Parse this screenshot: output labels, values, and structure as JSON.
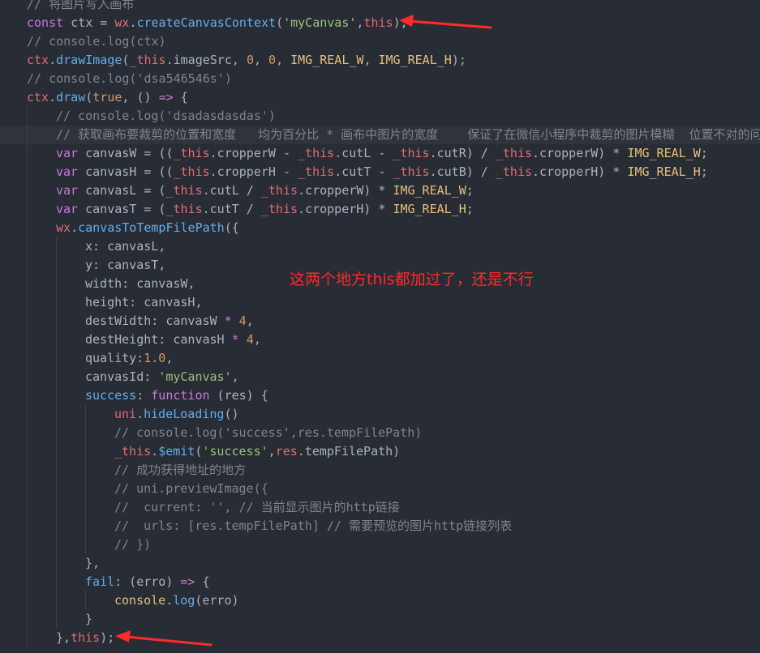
{
  "colors": {
    "background": "#282c34",
    "text": "#abb2bf",
    "keyword": "#c678dd",
    "function": "#61afef",
    "object": "#e06c75",
    "string": "#98c379",
    "number": "#d19a66",
    "constant": "#e5c07b",
    "comment": "#7f848e",
    "annotation": "#ff2a2a"
  },
  "annotation": {
    "text": "这两个地方this都加过了，还是不行"
  },
  "lines": [
    {
      "indent": 0,
      "tokens": [
        {
          "t": "// 将图片写入画布",
          "c": "comment"
        }
      ]
    },
    {
      "indent": 0,
      "tokens": [
        {
          "t": "const ",
          "c": "keyword"
        },
        {
          "t": "ctx = ",
          "c": "text"
        },
        {
          "t": "wx",
          "c": "object"
        },
        {
          "t": ".",
          "c": "text"
        },
        {
          "t": "createCanvasContext",
          "c": "function"
        },
        {
          "t": "(",
          "c": "text"
        },
        {
          "t": "'myCanvas'",
          "c": "string"
        },
        {
          "t": ",",
          "c": "text"
        },
        {
          "t": "this",
          "c": "object"
        },
        {
          "t": ");",
          "c": "text"
        }
      ]
    },
    {
      "indent": 0,
      "tokens": [
        {
          "t": "// console.log(ctx)",
          "c": "comment"
        }
      ]
    },
    {
      "indent": 0,
      "tokens": [
        {
          "t": "ctx",
          "c": "object"
        },
        {
          "t": ".",
          "c": "text"
        },
        {
          "t": "drawImage",
          "c": "function"
        },
        {
          "t": "(",
          "c": "text"
        },
        {
          "t": "_this",
          "c": "object"
        },
        {
          "t": ".imageSrc, ",
          "c": "text"
        },
        {
          "t": "0",
          "c": "number"
        },
        {
          "t": ", ",
          "c": "text"
        },
        {
          "t": "0",
          "c": "number"
        },
        {
          "t": ", ",
          "c": "text"
        },
        {
          "t": "IMG_REAL_W",
          "c": "constant"
        },
        {
          "t": ", ",
          "c": "text"
        },
        {
          "t": "IMG_REAL_H",
          "c": "constant"
        },
        {
          "t": ");",
          "c": "text"
        }
      ]
    },
    {
      "indent": 0,
      "tokens": [
        {
          "t": "// console.log('dsa546546s')",
          "c": "comment"
        }
      ]
    },
    {
      "indent": 0,
      "tokens": [
        {
          "t": "ctx",
          "c": "object"
        },
        {
          "t": ".",
          "c": "text"
        },
        {
          "t": "draw",
          "c": "function"
        },
        {
          "t": "(",
          "c": "text"
        },
        {
          "t": "true",
          "c": "number"
        },
        {
          "t": ", () ",
          "c": "text"
        },
        {
          "t": "=>",
          "c": "keyword"
        },
        {
          "t": " {",
          "c": "text"
        }
      ]
    },
    {
      "indent": 1,
      "tokens": [
        {
          "t": "// console.log('dsadasdasdas')",
          "c": "comment"
        }
      ]
    },
    {
      "indent": 1,
      "highlight": true,
      "tokens": [
        {
          "t": "// 获取画布要裁剪的位置和宽度   均为百分比 * 画布中图片的宽度    保证了在微信小程序中裁剪的图片模糊  位置不对的问题",
          "c": "comment"
        }
      ]
    },
    {
      "indent": 1,
      "tokens": [
        {
          "t": "var ",
          "c": "keyword"
        },
        {
          "t": "canvasW = ((",
          "c": "text"
        },
        {
          "t": "_this",
          "c": "object"
        },
        {
          "t": ".cropperW - ",
          "c": "text"
        },
        {
          "t": "_this",
          "c": "object"
        },
        {
          "t": ".cutL - ",
          "c": "text"
        },
        {
          "t": "_this",
          "c": "object"
        },
        {
          "t": ".cutR) / ",
          "c": "text"
        },
        {
          "t": "_this",
          "c": "object"
        },
        {
          "t": ".cropperW) * ",
          "c": "text"
        },
        {
          "t": "IMG_REAL_W",
          "c": "constant"
        },
        {
          "t": ";",
          "c": "text"
        }
      ]
    },
    {
      "indent": 1,
      "tokens": [
        {
          "t": "var ",
          "c": "keyword"
        },
        {
          "t": "canvasH = ((",
          "c": "text"
        },
        {
          "t": "_this",
          "c": "object"
        },
        {
          "t": ".cropperH - ",
          "c": "text"
        },
        {
          "t": "_this",
          "c": "object"
        },
        {
          "t": ".cutT - ",
          "c": "text"
        },
        {
          "t": "_this",
          "c": "object"
        },
        {
          "t": ".cutB) / ",
          "c": "text"
        },
        {
          "t": "_this",
          "c": "object"
        },
        {
          "t": ".cropperH) * ",
          "c": "text"
        },
        {
          "t": "IMG_REAL_H",
          "c": "constant"
        },
        {
          "t": ";",
          "c": "text"
        }
      ]
    },
    {
      "indent": 1,
      "tokens": [
        {
          "t": "var ",
          "c": "keyword"
        },
        {
          "t": "canvasL = (",
          "c": "text"
        },
        {
          "t": "_this",
          "c": "object"
        },
        {
          "t": ".cutL / ",
          "c": "text"
        },
        {
          "t": "_this",
          "c": "object"
        },
        {
          "t": ".cropperW) * ",
          "c": "text"
        },
        {
          "t": "IMG_REAL_W",
          "c": "constant"
        },
        {
          "t": ";",
          "c": "text"
        }
      ]
    },
    {
      "indent": 1,
      "tokens": [
        {
          "t": "var ",
          "c": "keyword"
        },
        {
          "t": "canvasT = (",
          "c": "text"
        },
        {
          "t": "_this",
          "c": "object"
        },
        {
          "t": ".cutT / ",
          "c": "text"
        },
        {
          "t": "_this",
          "c": "object"
        },
        {
          "t": ".cropperH) * ",
          "c": "text"
        },
        {
          "t": "IMG_REAL_H",
          "c": "constant"
        },
        {
          "t": ";",
          "c": "text"
        }
      ]
    },
    {
      "indent": 1,
      "tokens": [
        {
          "t": "wx",
          "c": "object"
        },
        {
          "t": ".",
          "c": "text"
        },
        {
          "t": "canvasToTempFilePath",
          "c": "function"
        },
        {
          "t": "({",
          "c": "text"
        }
      ]
    },
    {
      "indent": 2,
      "tokens": [
        {
          "t": "x: canvasL,",
          "c": "text"
        }
      ]
    },
    {
      "indent": 2,
      "tokens": [
        {
          "t": "y: canvasT,",
          "c": "text"
        }
      ]
    },
    {
      "indent": 2,
      "tokens": [
        {
          "t": "width: canvasW,",
          "c": "text"
        }
      ]
    },
    {
      "indent": 2,
      "tokens": [
        {
          "t": "height: canvasH,",
          "c": "text"
        }
      ]
    },
    {
      "indent": 2,
      "tokens": [
        {
          "t": "destWidth: canvasW ",
          "c": "text"
        },
        {
          "t": "*",
          "c": "keyword"
        },
        {
          "t": " ",
          "c": "text"
        },
        {
          "t": "4",
          "c": "number"
        },
        {
          "t": ",",
          "c": "text"
        }
      ]
    },
    {
      "indent": 2,
      "tokens": [
        {
          "t": "destHeight: canvasH ",
          "c": "text"
        },
        {
          "t": "*",
          "c": "keyword"
        },
        {
          "t": " ",
          "c": "text"
        },
        {
          "t": "4",
          "c": "number"
        },
        {
          "t": ",",
          "c": "text"
        }
      ]
    },
    {
      "indent": 2,
      "tokens": [
        {
          "t": "quality:",
          "c": "text"
        },
        {
          "t": "1.0",
          "c": "number"
        },
        {
          "t": ",",
          "c": "text"
        }
      ]
    },
    {
      "indent": 2,
      "tokens": [
        {
          "t": "canvasId: ",
          "c": "text"
        },
        {
          "t": "'myCanvas'",
          "c": "string"
        },
        {
          "t": ",",
          "c": "text"
        }
      ]
    },
    {
      "indent": 2,
      "tokens": [
        {
          "t": "success",
          "c": "function"
        },
        {
          "t": ": ",
          "c": "text"
        },
        {
          "t": "function",
          "c": "keyword"
        },
        {
          "t": " (res) {",
          "c": "text"
        }
      ]
    },
    {
      "indent": 3,
      "tokens": [
        {
          "t": "uni",
          "c": "object"
        },
        {
          "t": ".",
          "c": "text"
        },
        {
          "t": "hideLoading",
          "c": "function"
        },
        {
          "t": "()",
          "c": "text"
        }
      ]
    },
    {
      "indent": 3,
      "tokens": [
        {
          "t": "// console.log('success',res.tempFilePath)",
          "c": "comment"
        }
      ]
    },
    {
      "indent": 3,
      "tokens": [
        {
          "t": "_this",
          "c": "object"
        },
        {
          "t": ".",
          "c": "text"
        },
        {
          "t": "$emit",
          "c": "function"
        },
        {
          "t": "(",
          "c": "text"
        },
        {
          "t": "'success'",
          "c": "string"
        },
        {
          "t": ",",
          "c": "text"
        },
        {
          "t": "res",
          "c": "object"
        },
        {
          "t": ".tempFilePath)",
          "c": "text"
        }
      ]
    },
    {
      "indent": 3,
      "tokens": [
        {
          "t": "// 成功获得地址的地方",
          "c": "comment"
        }
      ]
    },
    {
      "indent": 3,
      "tokens": [
        {
          "t": "// uni.previewImage({",
          "c": "comment"
        }
      ]
    },
    {
      "indent": 3,
      "tokens": [
        {
          "t": "//  current: '', // 当前显示图片的http链接",
          "c": "comment"
        }
      ]
    },
    {
      "indent": 3,
      "tokens": [
        {
          "t": "//  urls: [res.tempFilePath] // 需要预览的图片http链接列表",
          "c": "comment"
        }
      ]
    },
    {
      "indent": 3,
      "tokens": [
        {
          "t": "// })",
          "c": "comment"
        }
      ]
    },
    {
      "indent": 2,
      "tokens": [
        {
          "t": "},",
          "c": "text"
        }
      ]
    },
    {
      "indent": 2,
      "tokens": [
        {
          "t": "fail",
          "c": "function"
        },
        {
          "t": ": (erro) ",
          "c": "text"
        },
        {
          "t": "=>",
          "c": "keyword"
        },
        {
          "t": " {",
          "c": "text"
        }
      ]
    },
    {
      "indent": 3,
      "tokens": [
        {
          "t": "console",
          "c": "constant"
        },
        {
          "t": ".",
          "c": "text"
        },
        {
          "t": "log",
          "c": "function"
        },
        {
          "t": "(erro)",
          "c": "text"
        }
      ]
    },
    {
      "indent": 2,
      "tokens": [
        {
          "t": "}",
          "c": "text"
        }
      ]
    },
    {
      "indent": 1,
      "tokens": [
        {
          "t": "},",
          "c": "text"
        },
        {
          "t": "this",
          "c": "object"
        },
        {
          "t": ");",
          "c": "text"
        }
      ]
    }
  ]
}
